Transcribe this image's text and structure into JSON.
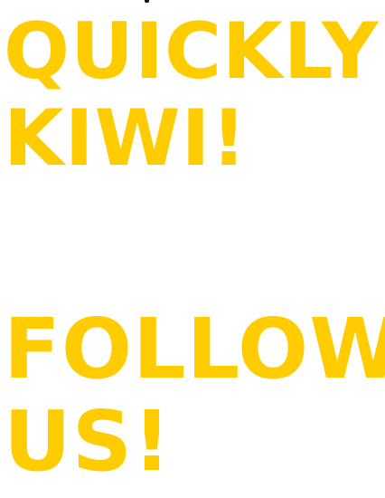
{
  "colors": {
    "accent": "#FFCC00",
    "background": "#FFFFFF"
  },
  "headline_primary": {
    "line_1": "QUICKLY",
    "line_2": "KIWI!"
  },
  "headline_secondary": {
    "line_1": "FOLLOW",
    "line_2": "US!"
  }
}
